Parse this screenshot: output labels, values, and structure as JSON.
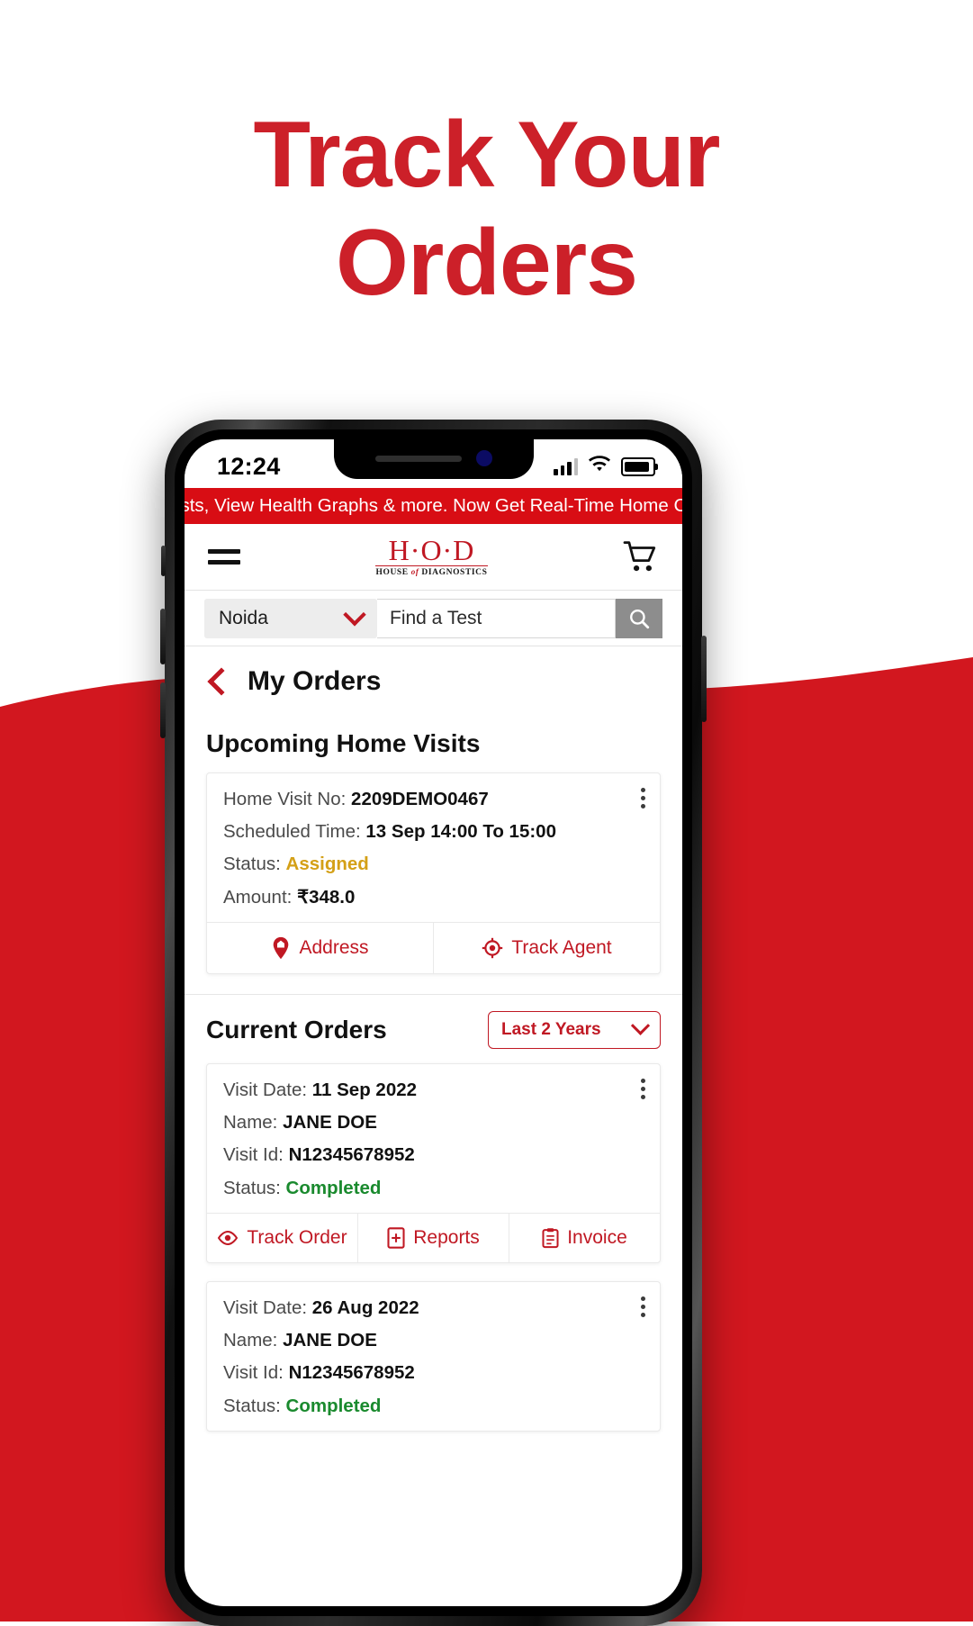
{
  "promo": {
    "headline_line1": "Track Your",
    "headline_line2": "Orders",
    "accent_color": "#cc2029",
    "background_color": "#d2171f"
  },
  "status_bar": {
    "time": "12:24",
    "signal_icon": "cellular-bars-icon",
    "wifi_icon": "wifi-icon",
    "battery_icon": "battery-full-icon"
  },
  "marquee": {
    "text": "ck Tests, View Health Graphs & more. Now Get Real-Time Home Co"
  },
  "app_header": {
    "menu_icon": "hamburger-menu-icon",
    "logo_main": "H·O·D",
    "logo_sub_pre": "HOUSE ",
    "logo_sub_em": "of",
    "logo_sub_post": " DIAGNOSTICS",
    "cart_icon": "shopping-cart-icon"
  },
  "search": {
    "city": "Noida",
    "city_chevron_icon": "chevron-down-icon",
    "placeholder": "Find a Test",
    "value": "",
    "search_icon": "search-icon"
  },
  "page": {
    "back_icon": "chevron-left-icon",
    "title": "My Orders"
  },
  "upcoming": {
    "heading": "Upcoming Home Visits",
    "card": {
      "visit_no_label": "Home Visit No:",
      "visit_no_value": "2209DEMO0467",
      "time_label": "Scheduled Time:",
      "time_value": "13 Sep 14:00 To 15:00",
      "status_label": "Status:",
      "status_value": "Assigned",
      "amount_label": "Amount:",
      "amount_value": "₹348.0",
      "kebab_icon": "more-vertical-icon",
      "actions": [
        {
          "label": "Address",
          "icon": "map-pin-home-icon"
        },
        {
          "label": "Track Agent",
          "icon": "target-crosshair-icon"
        }
      ]
    }
  },
  "current_orders": {
    "heading": "Current Orders",
    "filter_label": "Last 2 Years",
    "filter_chevron_icon": "chevron-down-icon",
    "orders": [
      {
        "date_label": "Visit Date:",
        "date_value": "11 Sep 2022",
        "name_label": "Name:",
        "name_value": "JANE DOE",
        "visit_id_label": "Visit Id:",
        "visit_id_value": "N12345678952",
        "status_label": "Status:",
        "status_value": "Completed",
        "kebab_icon": "more-vertical-icon",
        "actions": [
          {
            "label": "Track Order",
            "icon": "eye-icon"
          },
          {
            "label": "Reports",
            "icon": "file-plus-icon"
          },
          {
            "label": "Invoice",
            "icon": "clipboard-icon"
          }
        ]
      },
      {
        "date_label": "Visit Date:",
        "date_value": "26 Aug 2022",
        "name_label": "Name:",
        "name_value": "JANE DOE",
        "visit_id_label": "Visit Id:",
        "visit_id_value": "N12345678952",
        "status_label": "Status:",
        "status_value": "Completed",
        "kebab_icon": "more-vertical-icon",
        "actions": []
      }
    ]
  }
}
